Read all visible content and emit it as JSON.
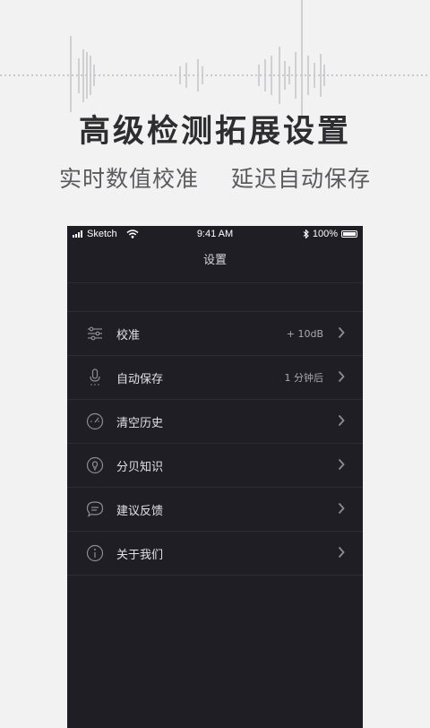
{
  "headline": "高级检测拓展设置",
  "subline": {
    "left": "实时数值校准",
    "right": "延迟自动保存"
  },
  "status_bar": {
    "carrier": "Sketch",
    "time": "9:41 AM",
    "battery": "100%"
  },
  "screen_title": "设置",
  "menu": [
    {
      "label": "校准",
      "value": "+ 10dB",
      "icon": "sliders-icon"
    },
    {
      "label": "自动保存",
      "value": "1 分钟后",
      "icon": "microphone-icon"
    },
    {
      "label": "清空历史",
      "value": "",
      "icon": "gauge-icon"
    },
    {
      "label": "分贝知识",
      "value": "",
      "icon": "lightbulb-icon"
    },
    {
      "label": "建议反馈",
      "value": "",
      "icon": "chat-bubble-icon"
    },
    {
      "label": "关于我们",
      "value": "",
      "icon": "info-icon"
    }
  ],
  "colors": {
    "page_background": "#f2f2f3",
    "phone_background": "#1f1e24",
    "text_light": "#e2e2e6",
    "divider": "#2c2c33"
  }
}
